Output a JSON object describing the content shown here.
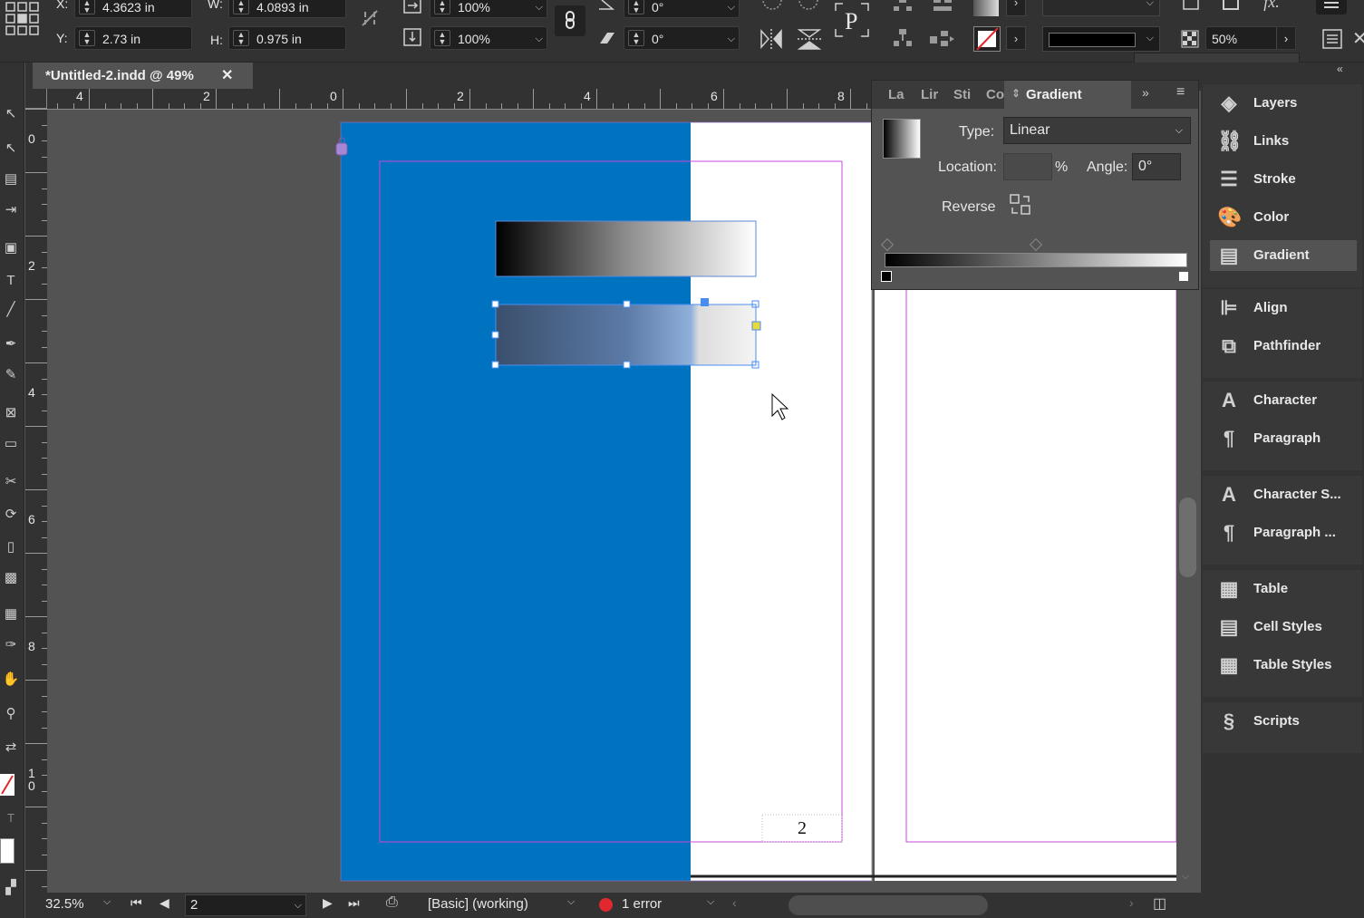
{
  "control": {
    "x_label": "X:",
    "x_value": "4.3623 in",
    "y_label": "Y:",
    "y_value": "2.73 in",
    "w_label": "W:",
    "w_value": "4.0893 in",
    "h_label": "H:",
    "h_value": "0.975 in",
    "scale_x": "100%",
    "scale_y": "100%",
    "rotate": "0°",
    "shear": "0°",
    "zoom_field": "50%",
    "opacity_slider_value": 50
  },
  "document": {
    "tab_title": "*Untitled-2.indd @ 49%",
    "page_number": "2"
  },
  "rulers": {
    "h_numbers": [
      "4",
      "2",
      "0",
      "2",
      "4",
      "6",
      "8"
    ],
    "v_numbers": [
      "0",
      "2",
      "4",
      "6",
      "8",
      "1\n0"
    ]
  },
  "gradient_panel": {
    "tabs": [
      "La",
      "Lir",
      "Sti",
      "Co"
    ],
    "active_tab": "Gradient",
    "type_label": "Type:",
    "type_value": "Linear",
    "location_label": "Location:",
    "location_value": "",
    "percent": "%",
    "angle_label": "Angle:",
    "angle_value": "0°",
    "reverse_label": "Reverse"
  },
  "dock": {
    "groups": [
      {
        "items": [
          {
            "label": "Layers",
            "icon": "layers-icon"
          },
          {
            "label": "Links",
            "icon": "links-icon"
          },
          {
            "label": "Stroke",
            "icon": "stroke-icon"
          },
          {
            "label": "Color",
            "icon": "color-palette-icon"
          },
          {
            "label": "Gradient",
            "icon": "gradient-icon",
            "active": true
          }
        ]
      },
      {
        "items": [
          {
            "label": "Align",
            "icon": "align-icon"
          },
          {
            "label": "Pathfinder",
            "icon": "pathfinder-icon"
          }
        ]
      },
      {
        "items": [
          {
            "label": "Character",
            "icon": "character-icon"
          },
          {
            "label": "Paragraph",
            "icon": "paragraph-icon"
          }
        ]
      },
      {
        "items": [
          {
            "label": "Character S...",
            "icon": "character-styles-icon"
          },
          {
            "label": "Paragraph ...",
            "icon": "paragraph-styles-icon"
          }
        ]
      },
      {
        "items": [
          {
            "label": "Table",
            "icon": "table-icon"
          },
          {
            "label": "Cell Styles",
            "icon": "cell-styles-icon"
          },
          {
            "label": "Table Styles",
            "icon": "table-styles-icon"
          }
        ]
      },
      {
        "items": [
          {
            "label": "Scripts",
            "icon": "scripts-icon"
          }
        ]
      }
    ]
  },
  "status": {
    "zoom": "32.5%",
    "page": "2",
    "style": "[Basic] (working)",
    "errors": "1 error"
  },
  "colors": {
    "accent_blue": "#0073c0",
    "error_red": "#e0282e",
    "selection_blue": "#4a8df0",
    "margin_magenta": "#c64ad8"
  }
}
